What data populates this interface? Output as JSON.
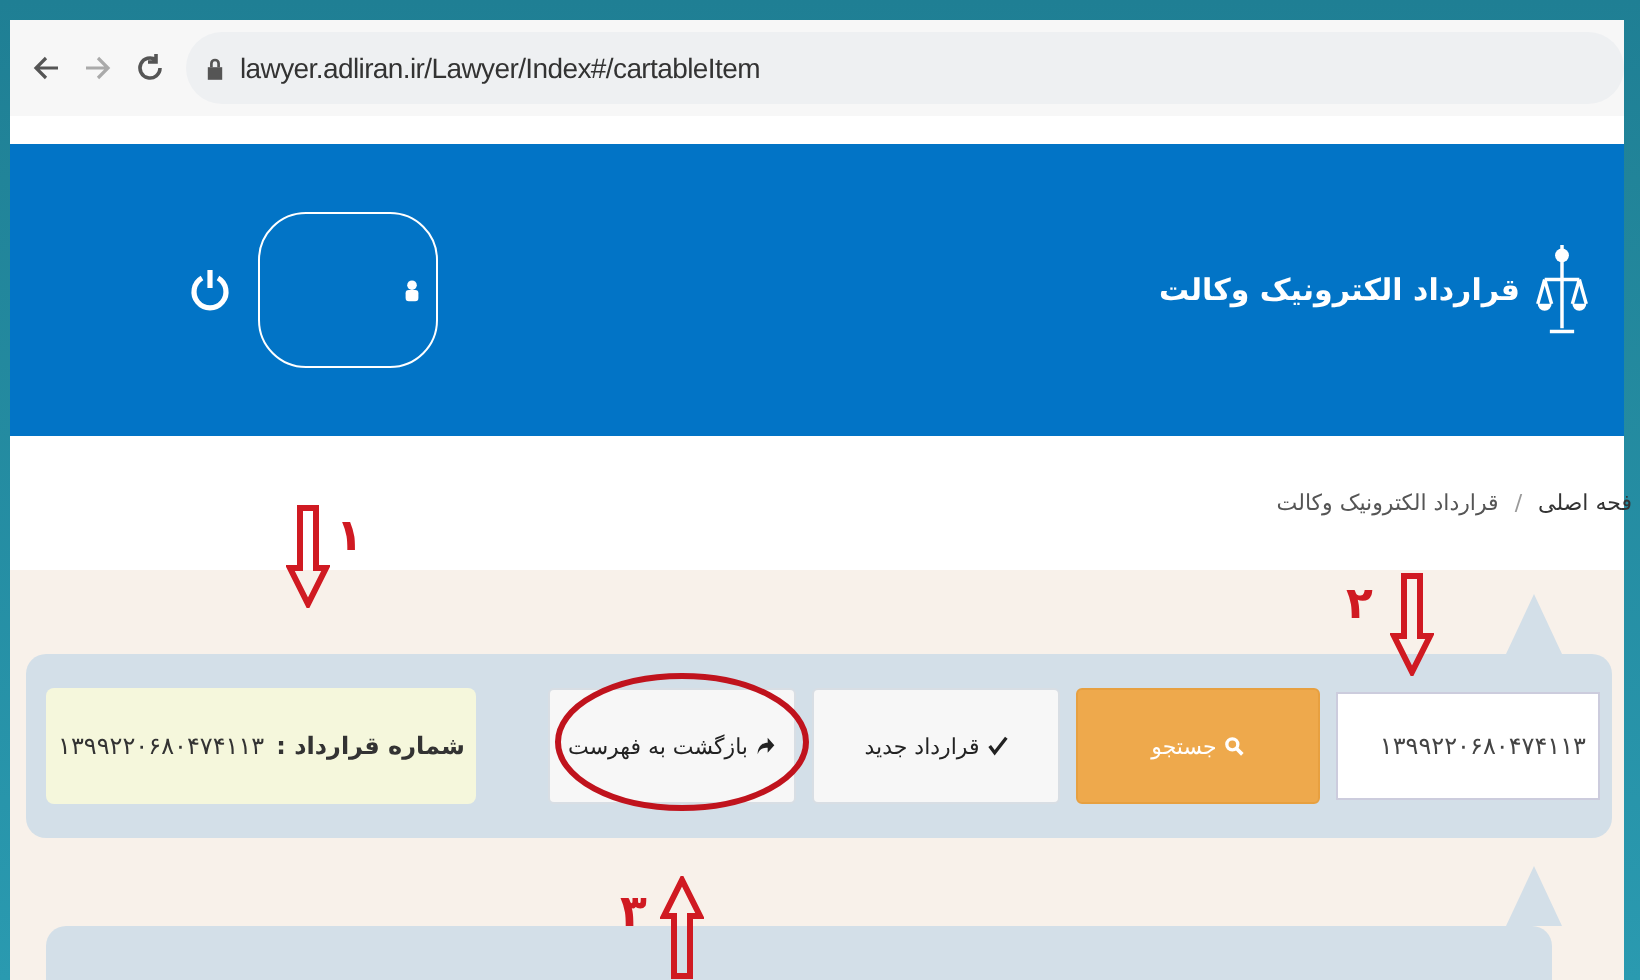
{
  "browser": {
    "url": "lawyer.adliran.ir/Lawyer/Index#/cartableItem"
  },
  "header": {
    "title": "قرارداد الکترونیک وکالت"
  },
  "breadcrumb": [
    "فحه اصلی",
    "قرارداد الکترونیک وکالت"
  ],
  "breadcrumb_separator": "/",
  "search": {
    "value": "۱۳۹۹۲۲۰۶۸۰۴۷۴۱۱۳"
  },
  "buttons": [
    {
      "label": "جستجو",
      "kind": "search"
    },
    {
      "label": "قرارداد جدید",
      "kind": "new"
    },
    {
      "label": "بازگشت به فهرست",
      "kind": "back"
    }
  ],
  "contract": {
    "label": "شماره قرارداد :",
    "number": "۱۳۹۹۲۲۰۶۸۰۴۷۴۱۱۳"
  },
  "annotations": [
    {
      "label": "۱",
      "kind": "down"
    },
    {
      "label": "۲",
      "kind": "down"
    },
    {
      "label": "۳",
      "kind": "up"
    }
  ]
}
